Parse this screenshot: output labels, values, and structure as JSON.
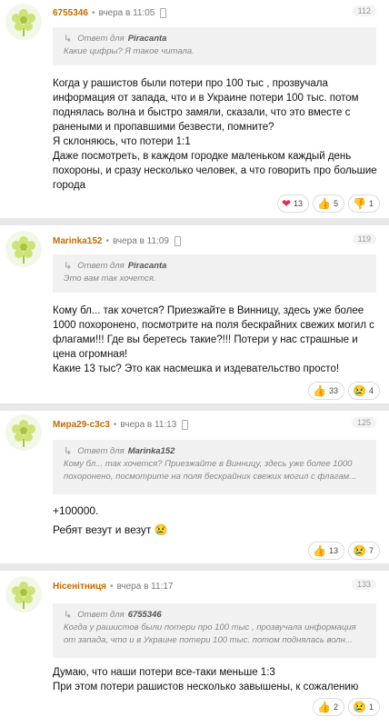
{
  "quote_prefix": "Ответ для",
  "comments": [
    {
      "user": "6755346",
      "time": "вчера в 11:05",
      "number": "112",
      "quote": {
        "to": "Piracanta",
        "text": "Какие цифры? Я такое читала."
      },
      "lines": [
        "Когда у рашистов были потери про 100 тыс , прозвучала информация от запада, что и в Украине потери 100 тыс. потом поднялась волна и быстро замяли, сказали, что это вместе с ранеными и пропавшими безвести, помните?",
        "Я склоняюсь, что потери 1:1",
        "Даже посмотреть, в каждом городке маленьком каждый день похороны, и сразу несколько человек, а что говорить про большие города"
      ],
      "reactions": [
        {
          "icon": "heart-icon",
          "glyph": "❤",
          "count": "13"
        },
        {
          "icon": "thumbs-up-icon",
          "glyph": "👍",
          "count": "5"
        },
        {
          "icon": "thumbs-down-icon",
          "glyph": "👎",
          "count": "1"
        }
      ]
    },
    {
      "user": "Marinka152",
      "time": "вчера в 11:09",
      "number": "119",
      "quote": {
        "to": "Piracanta",
        "text": "Это вам так хочется."
      },
      "lines": [
        "Кому бл... так хочется? Приезжайте в Винницу, здесь уже более 1000 похоронено, посмотрите на поля бескрайних свежих могил с флагами!!! Где вы беретесь такие?!!! Потери у нас страшные и цена огромная!",
        "Какие 13 тыс? Это как насмешка и издевательство просто!"
      ],
      "reactions": [
        {
          "icon": "thumbs-up-icon",
          "glyph": "👍",
          "count": "33"
        },
        {
          "icon": "sad-face-icon",
          "glyph": "😢",
          "count": "4"
        }
      ]
    },
    {
      "user": "Мира29-с3с3",
      "time": "вчера в 11:13",
      "number": "125",
      "quote": {
        "to": "Marinka152",
        "text": "Кому бл... так хочется? Приезжайте в Винницу, здесь уже более 1000 похоронено, посмотрите на поля бескрайних свежих могил с флагам..."
      },
      "lines": [
        "+100000.",
        "Ребят везут и везут 😢"
      ],
      "reactions": [
        {
          "icon": "thumbs-up-icon",
          "glyph": "👍",
          "count": "13"
        },
        {
          "icon": "sad-face-icon",
          "glyph": "😢",
          "count": "7"
        }
      ]
    },
    {
      "user": "Нісенітниця",
      "time": "вчера в 11:17",
      "number": "133",
      "quote": {
        "to": "6755346",
        "text": "Когда у рашистов были потери про 100 тыс , прозвучала информация от запада, что и в Украине потери 100 тыс. потом поднялась волн..."
      },
      "lines": [
        "Думаю, что наши потери все-таки меньше 1:3",
        "При этом потери рашистов несколько завышены, к сожалению"
      ],
      "reactions": [
        {
          "icon": "thumbs-up-icon",
          "glyph": "👍",
          "count": "2"
        },
        {
          "icon": "sad-face-icon",
          "glyph": "😢",
          "count": "1"
        }
      ]
    }
  ]
}
